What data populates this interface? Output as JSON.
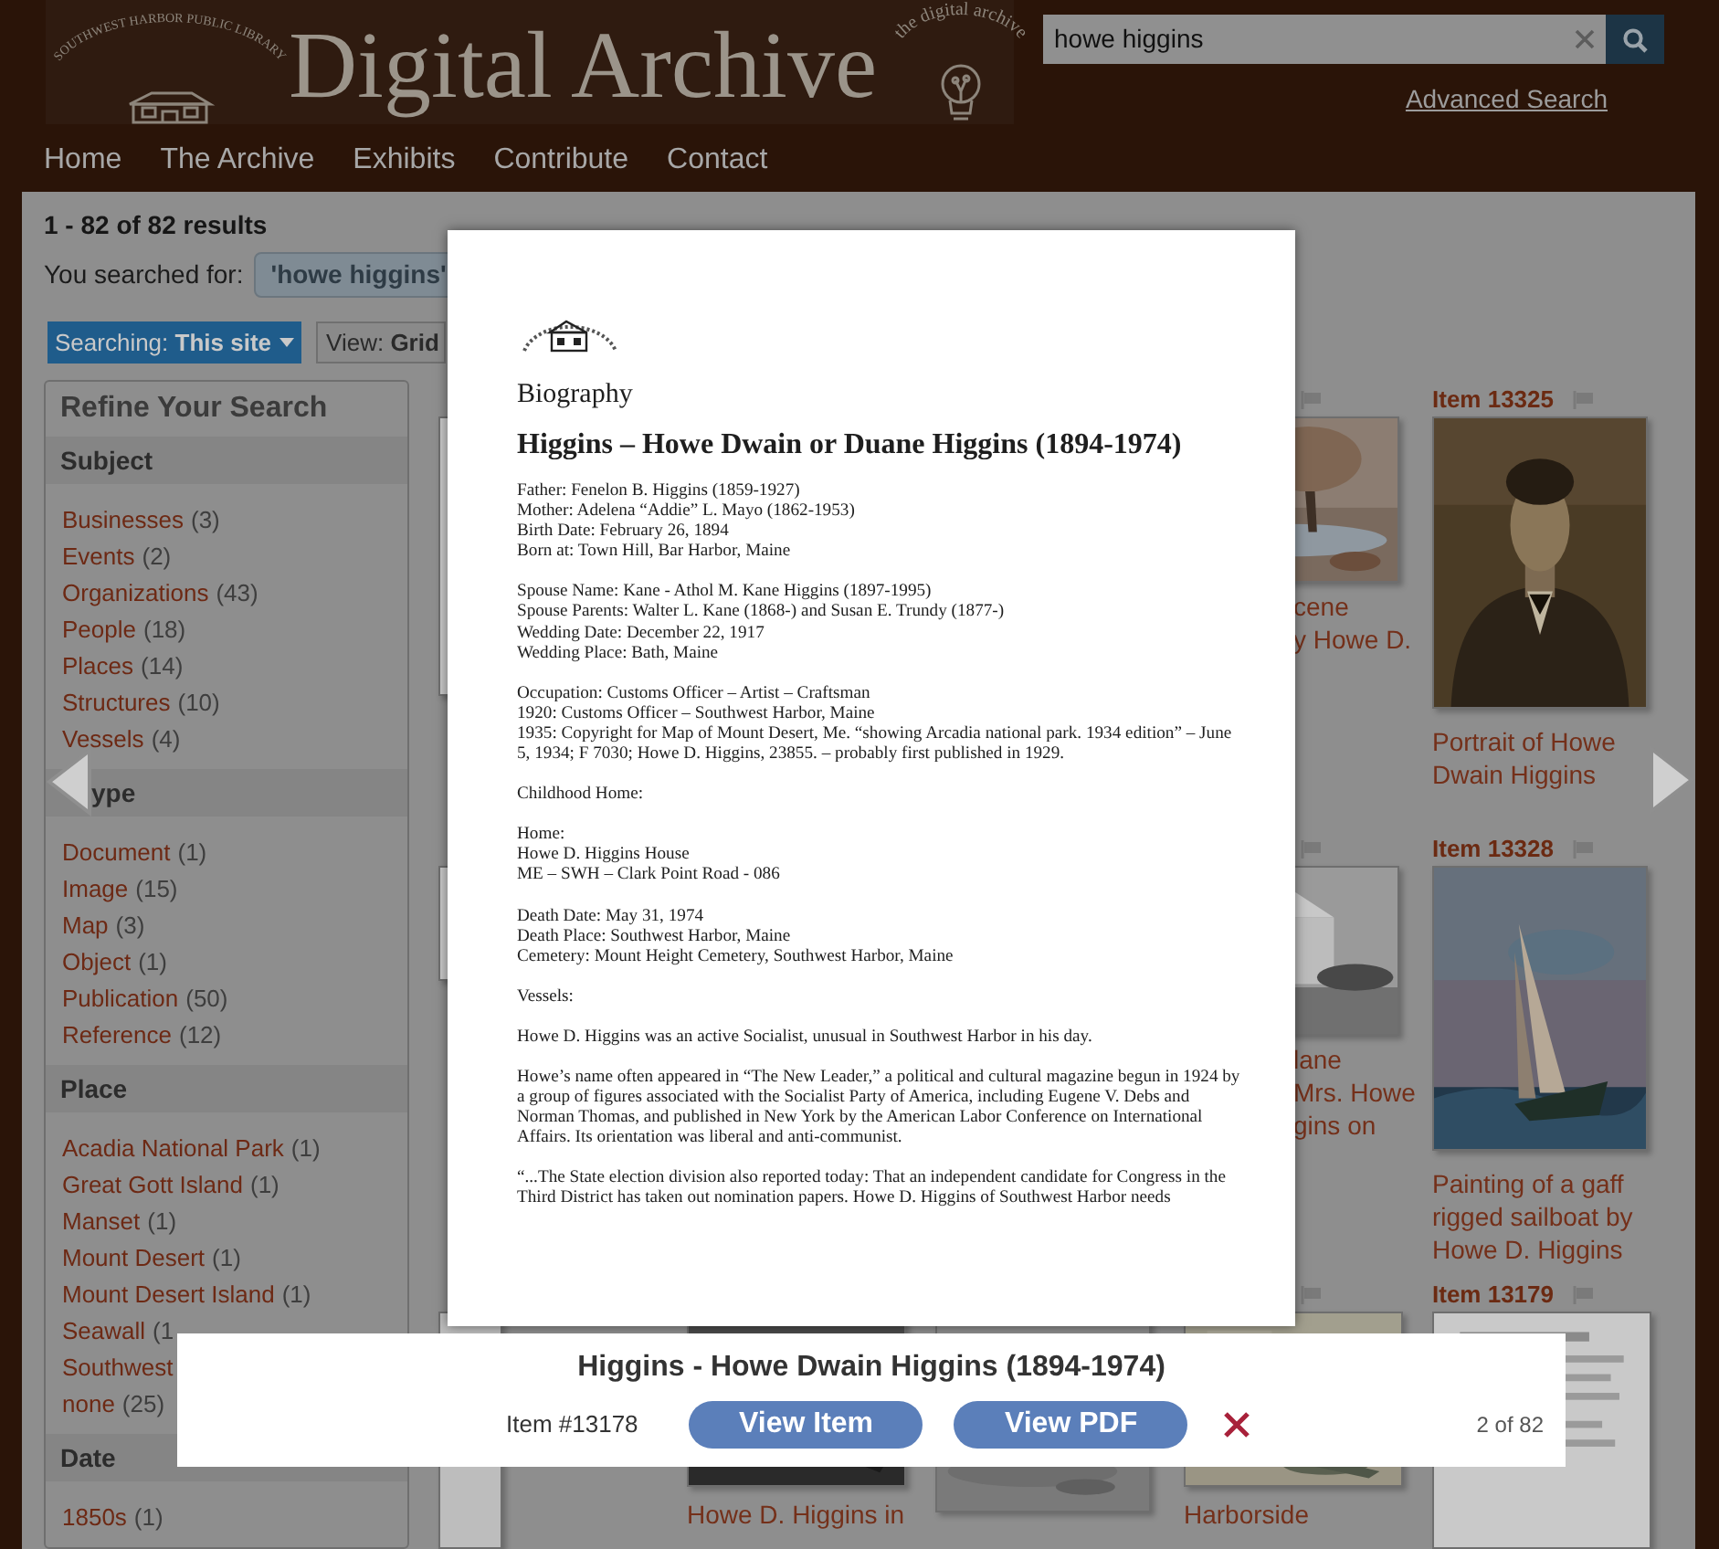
{
  "header": {
    "logo_arc": "SOUTHWEST HARBOR PUBLIC LIBRARY",
    "site_title": "Digital Archive",
    "badge_arc": "the digital archive",
    "search": {
      "value": "howe higgins"
    },
    "advanced_search": "Advanced Search"
  },
  "nav": [
    "Home",
    "The Archive",
    "Exhibits",
    "Contribute",
    "Contact"
  ],
  "results": {
    "count": "1 - 82 of 82 results",
    "searched_label": "You searched for:",
    "query_chip": "'howe higgins'",
    "scope": "Searching: **This site**",
    "view": "View: **Grid**"
  },
  "refine": {
    "title": "Refine Your Search",
    "sections": [
      {
        "heading": "Subject",
        "items": [
          {
            "label": "Businesses",
            "count": "(3)"
          },
          {
            "label": "Events",
            "count": "(2)"
          },
          {
            "label": "Organizations",
            "count": "(43)"
          },
          {
            "label": "People",
            "count": "(18)"
          },
          {
            "label": "Places",
            "count": "(14)"
          },
          {
            "label": "Structures",
            "count": "(10)"
          },
          {
            "label": "Vessels",
            "count": "(4)"
          }
        ]
      },
      {
        "heading": "ype",
        "items": [
          {
            "label": "Document",
            "count": "(1)"
          },
          {
            "label": "Image",
            "count": "(15)"
          },
          {
            "label": "Map",
            "count": "(3)"
          },
          {
            "label": "Object",
            "count": "(1)"
          },
          {
            "label": "Publication",
            "count": "(50)"
          },
          {
            "label": "Reference",
            "count": "(12)"
          }
        ]
      },
      {
        "heading": "Place",
        "items": [
          {
            "label": "Acadia National Park",
            "count": "(1)"
          },
          {
            "label": "Great Gott Island",
            "count": "(1)"
          },
          {
            "label": "Manset",
            "count": "(1)"
          },
          {
            "label": "Mount Desert",
            "count": "(1)"
          },
          {
            "label": "Mount Desert Island",
            "count": "(1)"
          },
          {
            "label": "Seawall",
            "count": "(1"
          },
          {
            "label": "Southwest"
          },
          {
            "label": "none",
            "count": "(25)"
          }
        ]
      },
      {
        "heading": "Date",
        "items": [
          {
            "label": "1850s",
            "count": "(1)"
          }
        ]
      }
    ]
  },
  "grid": [
    [
      {
        "kind": "peek-right",
        "captions": [
          "cene",
          "y Howe D."
        ]
      },
      {
        "kind": "full",
        "item": "Item 13325",
        "caption": "Portrait of Howe Dwain Higgins"
      }
    ],
    [
      {
        "kind": "peek-right",
        "captions": [
          "lane",
          "Mrs. Howe",
          "gins on"
        ]
      },
      {
        "kind": "full",
        "item": "Item 13328",
        "caption": "Painting of a gaff rigged sailboat by Howe D. Higgins"
      }
    ],
    [
      {
        "kind": "peek-bottom",
        "captions": [
          "Howe D. Higgins in"
        ]
      },
      {
        "kind": "peek-corner",
        "captions": [
          "Harborside"
        ]
      },
      {
        "kind": "full",
        "item": "Item 13179"
      }
    ]
  ],
  "document": {
    "title": "Biography",
    "heading": "Higgins – Howe Dwain or Duane Higgins (1894-1974)",
    "blocks": [
      [
        "Father: Fenelon B. Higgins (1859-1927)",
        "Mother: Adelena “Addie” L. Mayo (1862-1953)",
        "Birth Date: February 26, 1894",
        "Born at: Town Hill, Bar Harbor, Maine"
      ],
      [
        "Spouse Name: Kane - Athol M. Kane Higgins (1897-1995)",
        "Spouse Parents: Walter L. Kane (1868-) and Susan E. Trundy (1877-)",
        "Wedding Date: December 22, 1917",
        "Wedding Place: Bath, Maine"
      ],
      [
        "Occupation: Customs Officer – Artist – Craftsman",
        "1920: Customs Officer – Southwest Harbor, Maine",
        "1935: Copyright for Map of Mount Desert, Me. “showing Arcadia national park. 1934 edition” – June 5, 1934; F 7030; Howe D. Higgins, 23855. – probably first published in 1929."
      ],
      [
        "Childhood Home:"
      ],
      [
        "Home:",
        "Howe D. Higgins House",
        "ME – SWH – Clark Point Road - 086"
      ],
      [
        "Death Date: May 31, 1974",
        "Death Place: Southwest Harbor, Maine",
        "Cemetery: Mount Height Cemetery, Southwest Harbor, Maine"
      ],
      [
        "Vessels:"
      ],
      [
        "Howe D. Higgins was an active Socialist, unusual in Southwest Harbor in his day."
      ],
      [
        "Howe’s name often appeared in “The New Leader,” a political and cultural magazine begun in 1924 by a group of figures associated with the Socialist Party of America, including Eugene V. Debs and Norman Thomas, and published in New York by the American Labor Conference on International Affairs. Its orientation was liberal and anti-communist."
      ],
      [
        "“...The State election division also reported today: That an independent candidate for Congress in the Third District has taken out nomination papers. Howe D. Higgins of Southwest Harbor needs"
      ]
    ]
  },
  "lightbox": {
    "title": "Higgins - Howe Dwain Higgins (1894-1974)",
    "item_number": "Item #13178",
    "buttons": [
      "View Item",
      "View PDF"
    ],
    "position": "2 of 82"
  }
}
